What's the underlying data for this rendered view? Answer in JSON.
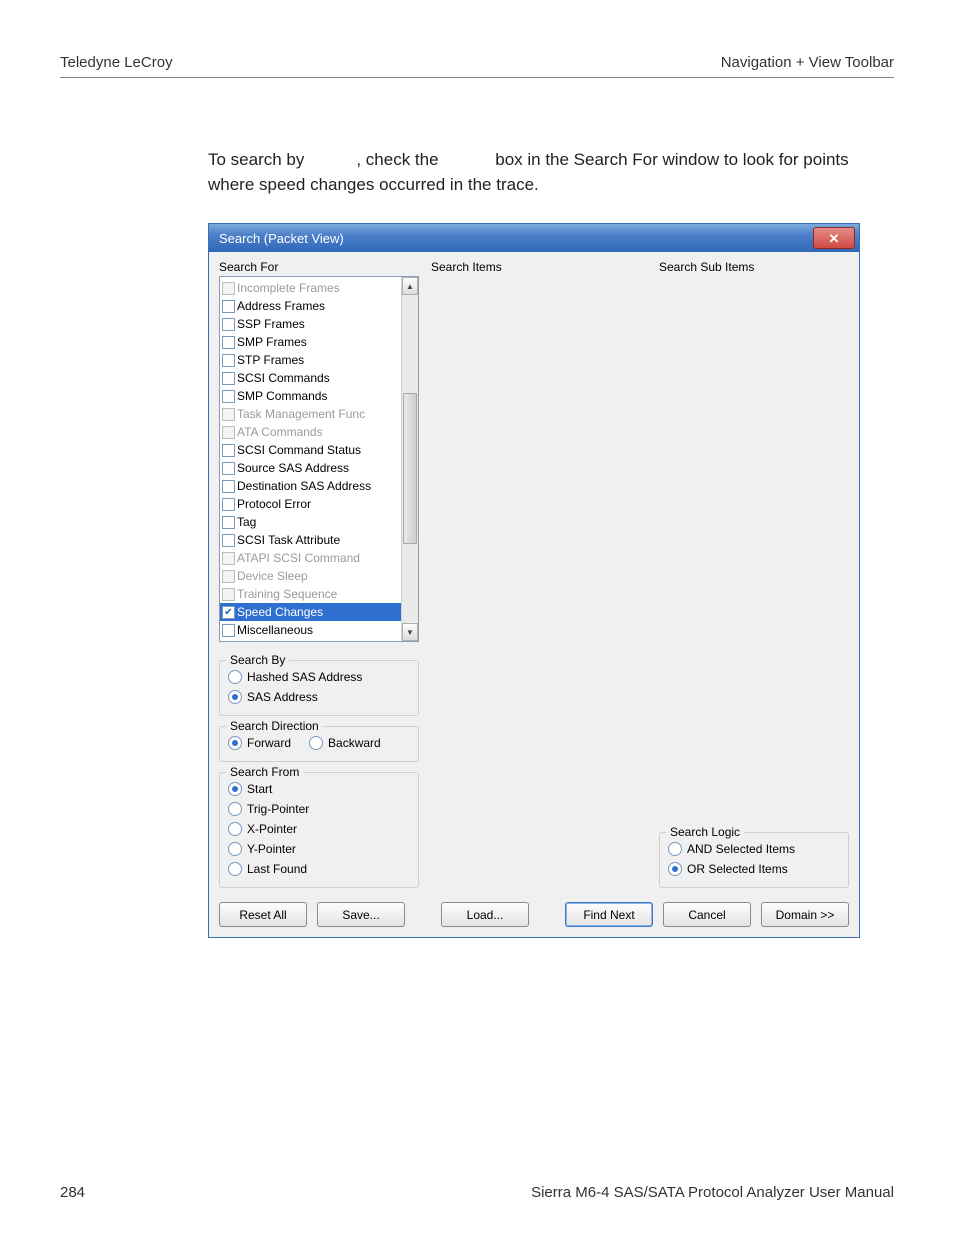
{
  "header": {
    "left": "Teledyne LeCroy",
    "right": "Navigation + View Toolbar"
  },
  "body": {
    "para1_a": "To search by ",
    "para1_b": ", check the ",
    "para1_c": " box in the Search For window to look for points where speed changes occurred in the trace."
  },
  "dialog": {
    "title": "Search (Packet View)",
    "close_glyph": "✕",
    "searchFor": {
      "label": "Search For",
      "items": [
        {
          "label": "Incomplete Frames",
          "checked": false,
          "disabled": true,
          "selected": false
        },
        {
          "label": "Address Frames",
          "checked": false,
          "disabled": false,
          "selected": false
        },
        {
          "label": "SSP Frames",
          "checked": false,
          "disabled": false,
          "selected": false
        },
        {
          "label": "SMP Frames",
          "checked": false,
          "disabled": false,
          "selected": false
        },
        {
          "label": "STP Frames",
          "checked": false,
          "disabled": false,
          "selected": false
        },
        {
          "label": "SCSI Commands",
          "checked": false,
          "disabled": false,
          "selected": false
        },
        {
          "label": "SMP Commands",
          "checked": false,
          "disabled": false,
          "selected": false
        },
        {
          "label": "Task Management Func",
          "checked": false,
          "disabled": true,
          "selected": false
        },
        {
          "label": "ATA Commands",
          "checked": false,
          "disabled": true,
          "selected": false
        },
        {
          "label": "SCSI Command Status",
          "checked": false,
          "disabled": false,
          "selected": false
        },
        {
          "label": "Source SAS Address",
          "checked": false,
          "disabled": false,
          "selected": false
        },
        {
          "label": "Destination SAS Address",
          "checked": false,
          "disabled": false,
          "selected": false
        },
        {
          "label": "Protocol Error",
          "checked": false,
          "disabled": false,
          "selected": false
        },
        {
          "label": "Tag",
          "checked": false,
          "disabled": false,
          "selected": false
        },
        {
          "label": "SCSI Task Attribute",
          "checked": false,
          "disabled": false,
          "selected": false
        },
        {
          "label": "ATAPI SCSI Command",
          "checked": false,
          "disabled": true,
          "selected": false
        },
        {
          "label": "Device Sleep",
          "checked": false,
          "disabled": true,
          "selected": false
        },
        {
          "label": "Training Sequence",
          "checked": false,
          "disabled": true,
          "selected": false
        },
        {
          "label": "Speed Changes",
          "checked": true,
          "disabled": false,
          "selected": true
        },
        {
          "label": "Miscellaneous",
          "checked": false,
          "disabled": false,
          "selected": false
        }
      ]
    },
    "searchItems": {
      "label": "Search Items"
    },
    "searchSubItems": {
      "label": "Search Sub Items"
    },
    "searchBy": {
      "legend": "Search By",
      "options": [
        {
          "label": "Hashed SAS Address",
          "selected": false
        },
        {
          "label": "SAS Address",
          "selected": true
        }
      ]
    },
    "searchDirection": {
      "legend": "Search Direction",
      "options": [
        {
          "label": "Forward",
          "selected": true
        },
        {
          "label": "Backward",
          "selected": false
        }
      ]
    },
    "searchFrom": {
      "legend": "Search From",
      "options": [
        {
          "label": "Start",
          "selected": true
        },
        {
          "label": "Trig-Pointer",
          "selected": false
        },
        {
          "label": "X-Pointer",
          "selected": false
        },
        {
          "label": "Y-Pointer",
          "selected": false
        },
        {
          "label": "Last Found",
          "selected": false
        }
      ]
    },
    "searchLogic": {
      "legend": "Search Logic",
      "options": [
        {
          "label": "AND Selected Items",
          "selected": false
        },
        {
          "label": "OR Selected Items",
          "selected": true
        }
      ]
    },
    "buttons": {
      "reset": "Reset All",
      "save": "Save...",
      "load": "Load...",
      "findNext": "Find Next",
      "cancel": "Cancel",
      "domain": "Domain >>"
    }
  },
  "footer": {
    "page": "284",
    "title": "Sierra M6-4 SAS/SATA Protocol Analyzer User Manual"
  }
}
